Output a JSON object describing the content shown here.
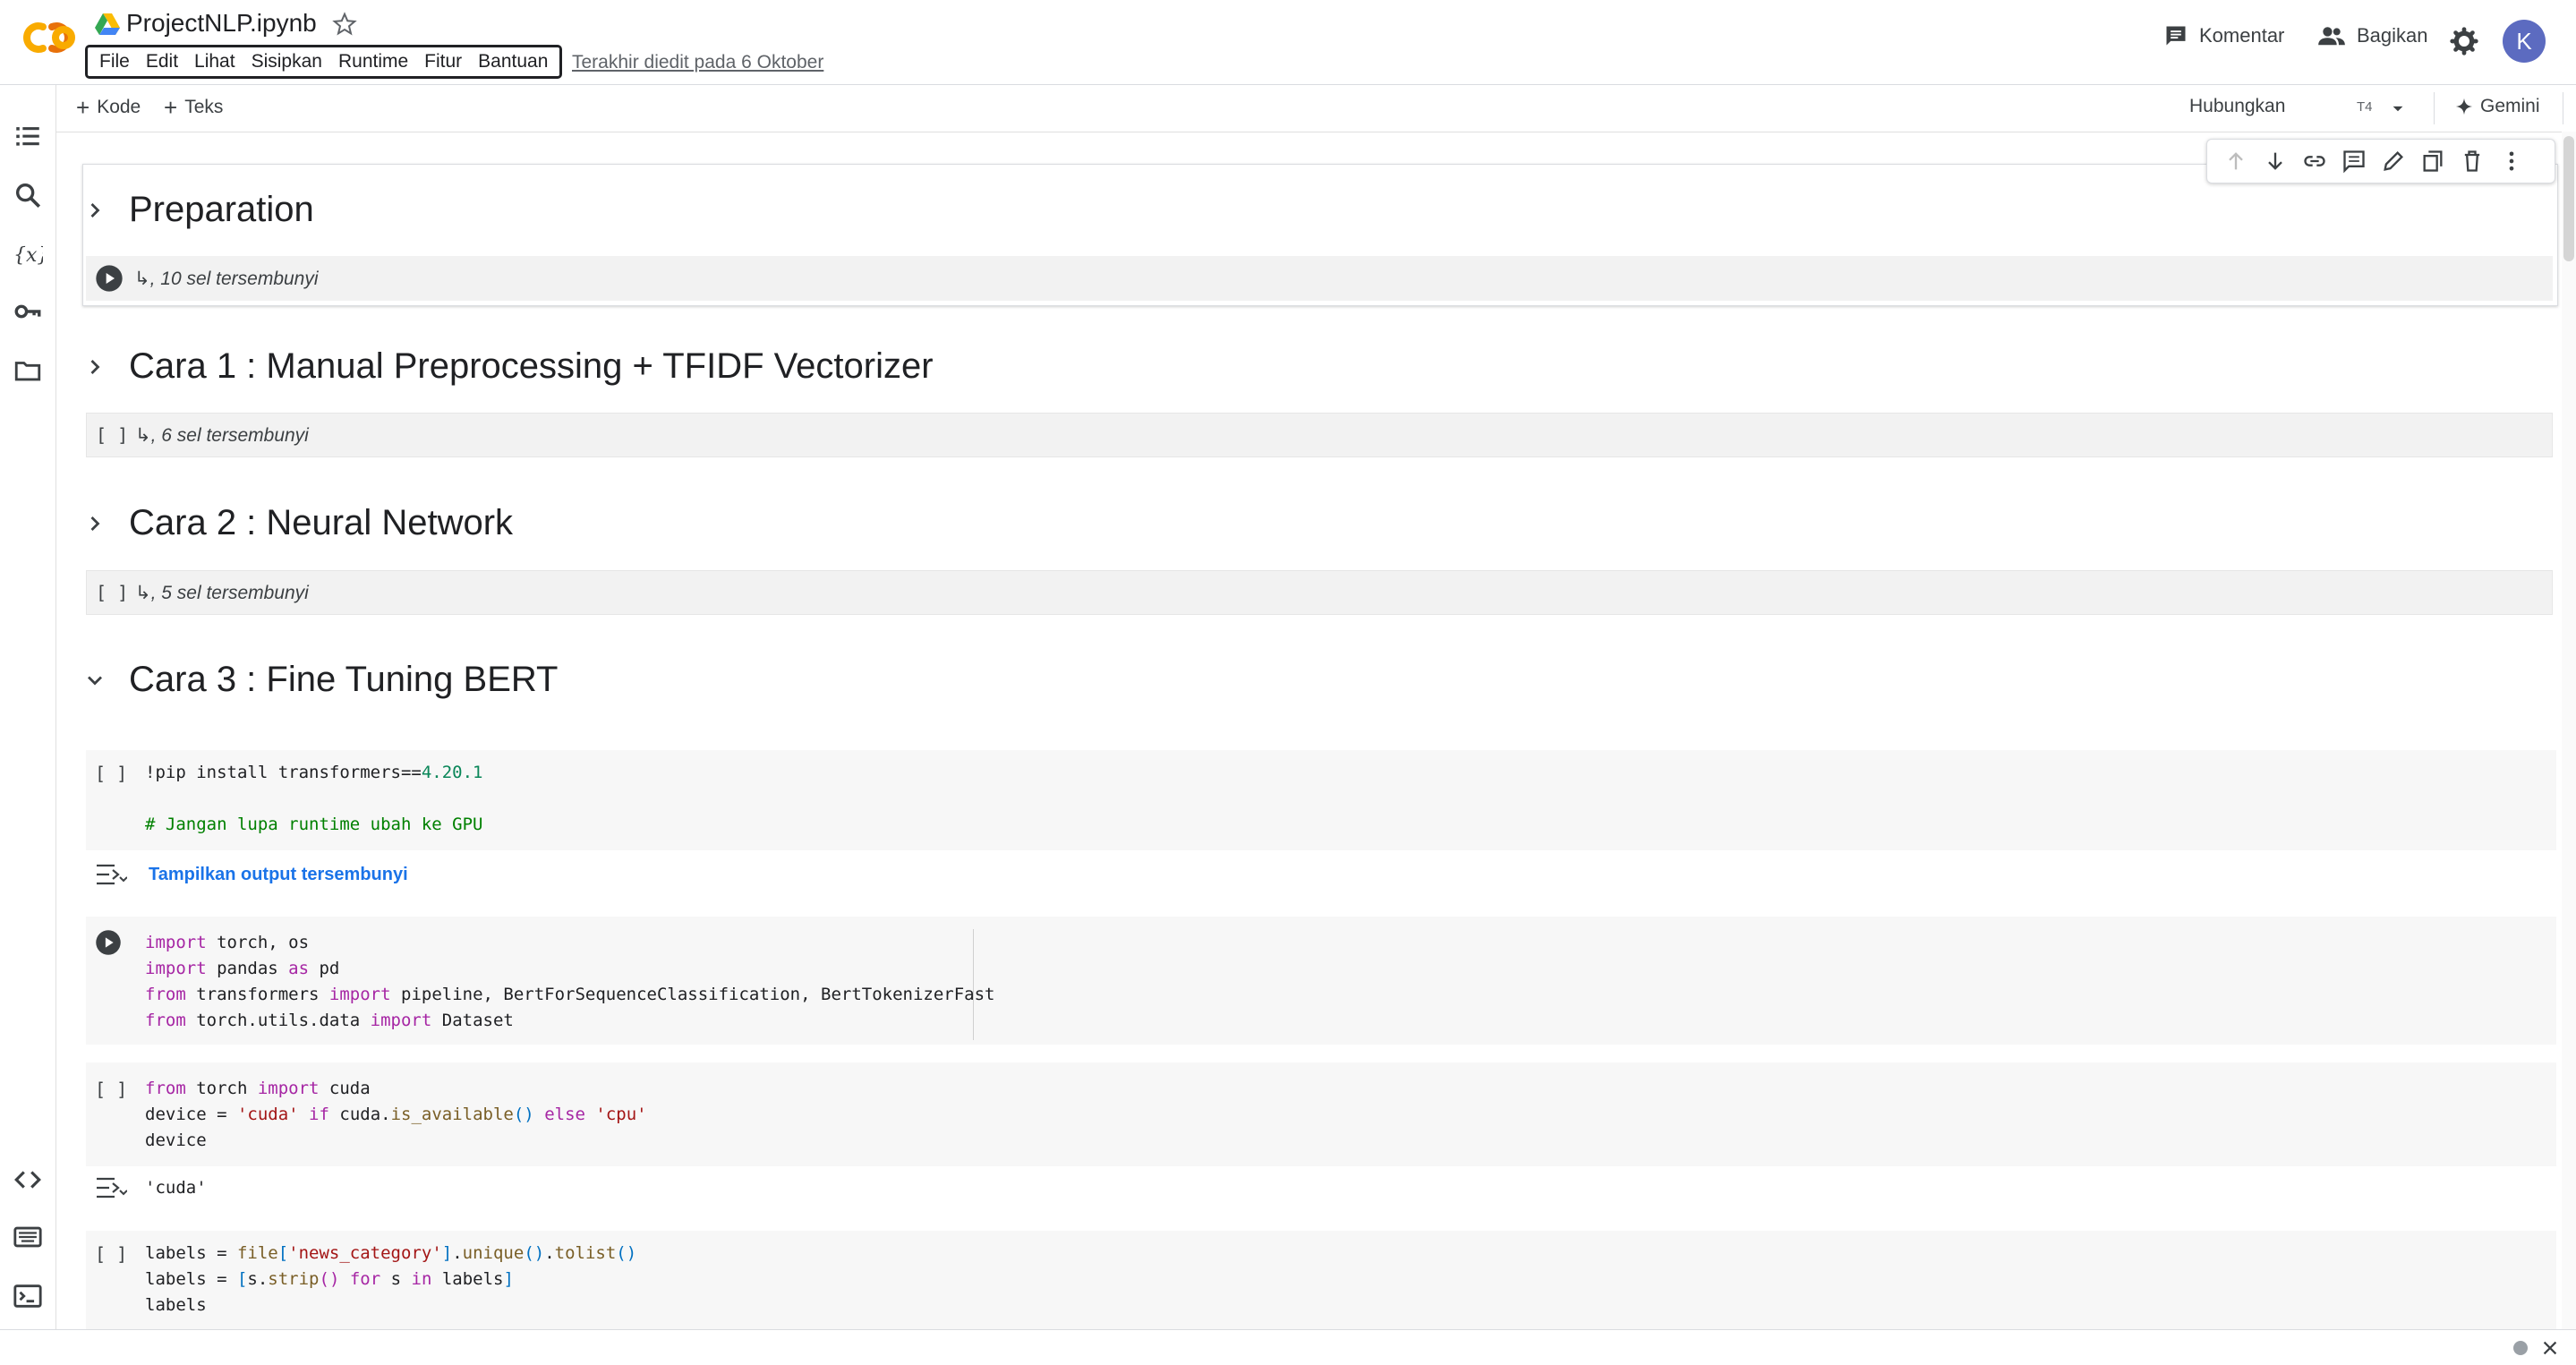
{
  "app": {
    "notebook_title": "ProjectNLP.ipynb",
    "menu": [
      "File",
      "Edit",
      "Lihat",
      "Sisipkan",
      "Runtime",
      "Fitur",
      "Bantuan"
    ],
    "last_edited": "Terakhir diedit pada 6 Oktober",
    "comment_label": "Komentar",
    "share_label": "Bagikan",
    "avatar_initial": "K"
  },
  "toolbar": {
    "add_code": "Kode",
    "add_text": "Teks",
    "connect": "Hubungkan",
    "runtime_badge": "T4",
    "gemini": "Gemini"
  },
  "sections": [
    {
      "title": "Preparation",
      "hidden": "10 sel tersembunyi",
      "bracket": "",
      "expanded": false
    },
    {
      "title": "Cara 1 : Manual Preprocessing + TFIDF Vectorizer",
      "hidden": "6 sel tersembunyi",
      "bracket": "[ ]",
      "expanded": false
    },
    {
      "title": "Cara 2 : Neural Network",
      "hidden": "5 sel tersembunyi",
      "bracket": "[ ]",
      "expanded": false
    },
    {
      "title": "Cara 3 : Fine Tuning BERT",
      "expanded": true
    }
  ],
  "cells": {
    "pip": {
      "bracket": "[ ]",
      "show_output": "Tampilkan output tersembunyi"
    },
    "imports": {},
    "cuda": {
      "bracket": "[ ]",
      "output": "'cuda'"
    },
    "labels": {
      "bracket": "[ ]"
    }
  }
}
